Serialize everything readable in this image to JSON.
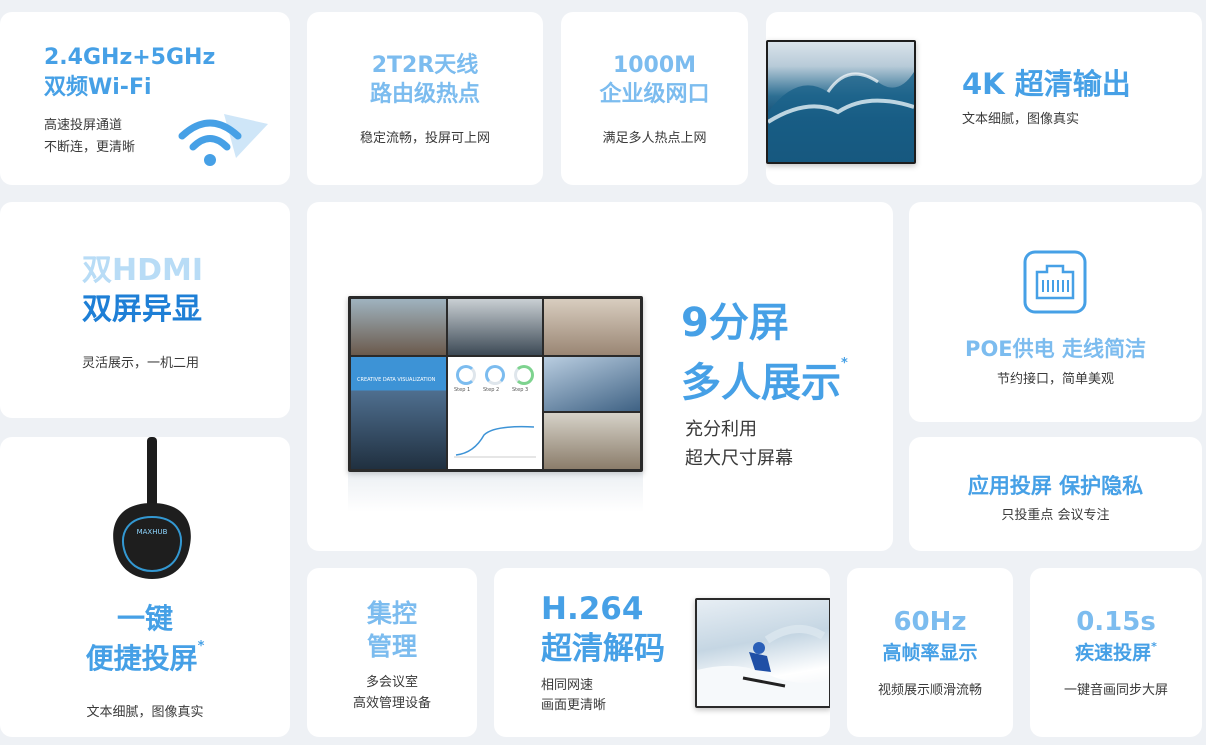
{
  "cards": {
    "wifi": {
      "title1": "2.4GHz+5GHz",
      "title2": "双频Wi-Fi",
      "sub1": "高速投屏通道",
      "sub2": "不断连，更清晰"
    },
    "antenna": {
      "title1": "2T2R天线",
      "title2": "路由级热点",
      "sub": "稳定流畅，投屏可上网"
    },
    "port": {
      "title1": "1000M",
      "title2": "企业级网口",
      "sub": "满足多人热点上网"
    },
    "output4k": {
      "title": "4K 超清输出",
      "sub": "文本细腻，图像真实"
    },
    "hdmi": {
      "title1": "双HDMI",
      "title2": "双屏异显",
      "sub": "灵活展示，一机二用"
    },
    "split": {
      "title1": "9分屏",
      "title2": "多人展示",
      "mark": "*",
      "sub1": "充分利用",
      "sub2": "超大尺寸屏幕",
      "screen_banner": "CREATIVE DATA VISUALIZATION",
      "steps": [
        "Step 1",
        "Step 2",
        "Step 3"
      ]
    },
    "poe": {
      "title": "POE供电 走线简洁",
      "sub": "节约接口，简单美观"
    },
    "privacy": {
      "title": "应用投屏 保护隐私",
      "sub": "只投重点 会议专注"
    },
    "onekey": {
      "title1": "一键",
      "title2": "便捷投屏",
      "mark": "*",
      "sub": "文本细腻，图像真实",
      "device_brand": "MAXHUB"
    },
    "control": {
      "title1": "集控",
      "title2": "管理",
      "sub1": "多会议室",
      "sub2": "高效管理设备"
    },
    "codec": {
      "title1": "H.264",
      "title2": "超清解码",
      "sub1": "相同网速",
      "sub2": "画面更清晰"
    },
    "hz": {
      "title1": "60Hz",
      "title2": "高帧率显示",
      "sub": "视频展示顺滑流畅"
    },
    "speed": {
      "title1": "0.15s",
      "title2": "疾速投屏",
      "mark": "*",
      "sub": "一键音画同步大屏"
    }
  },
  "colors": {
    "accent": "#46a0e6",
    "accent_light": "#a8d3f3",
    "accent_dark": "#1e7fd6",
    "background": "#eef1f5"
  }
}
